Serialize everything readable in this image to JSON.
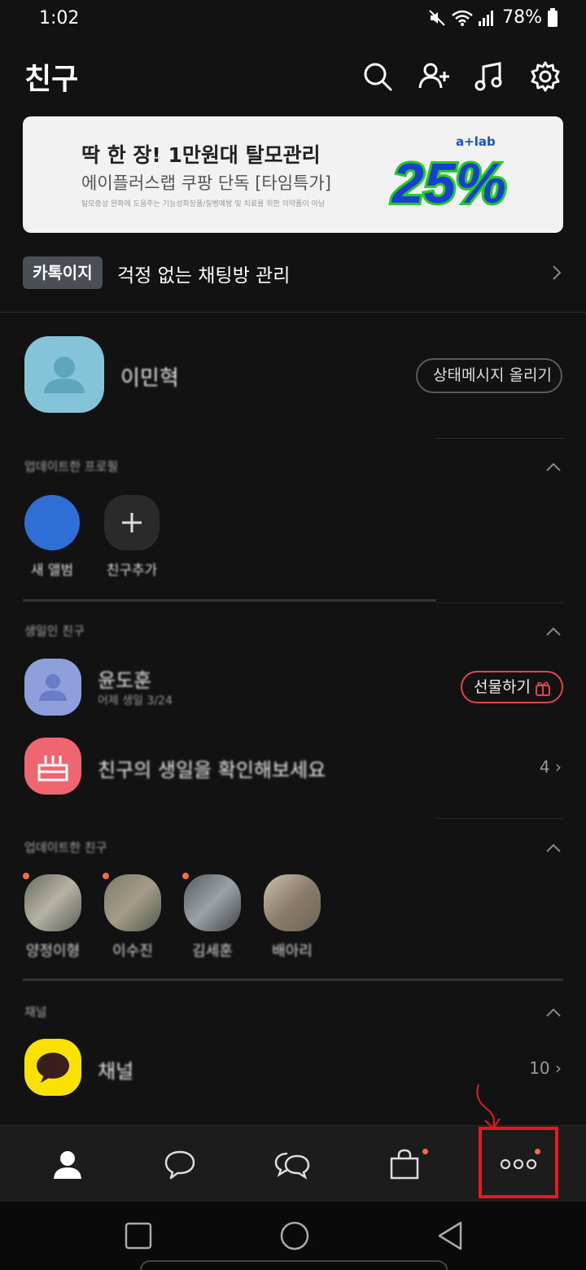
{
  "status_bar": {
    "time": "1:02",
    "battery": "78%"
  },
  "header": {
    "title": "친구",
    "icons": [
      "search-icon",
      "add-friend-icon",
      "music-icon",
      "settings-icon"
    ]
  },
  "ad": {
    "title": "딱 한 장! 1만원대 탈모관리",
    "subtitle": "에이플러스랩 쿠팡 단독 [타임특가]",
    "fine_print": "탈모증상 완화에 도움주는 기능성화장품/질병예방 및 치료를 위한 의약품이 아님",
    "brand": "a+lab",
    "badge": "25%"
  },
  "notice": {
    "tag": "카톡이지",
    "text": "걱정 없는 채팅방 관리"
  },
  "profile": {
    "name": "이민혁",
    "status_button": "상태메시지 올리기"
  },
  "sections": {
    "s1": {
      "title": "업데이트한 프로필",
      "tiles": [
        {
          "label": "새 앨범"
        },
        {
          "label": "친구추가"
        }
      ]
    },
    "s2": {
      "title": "생일인 친구",
      "rows": [
        {
          "name": "윤도훈",
          "sub": "어제 생일 3/24",
          "action": "선물하기"
        },
        {
          "name": "친구의 생일을 확인해보세요",
          "count": "4"
        }
      ]
    },
    "s3": {
      "title": "업데이트한 친구",
      "stories": [
        {
          "label": "양정이형"
        },
        {
          "label": "이수진"
        },
        {
          "label": "김세훈"
        },
        {
          "label": "배아리"
        }
      ]
    },
    "s4": {
      "title": "채널",
      "rows": [
        {
          "name": "채널",
          "count": "10"
        }
      ]
    }
  },
  "bottom_nav": {
    "items": [
      "friends-icon",
      "chat-icon",
      "openchat-icon",
      "shopping-icon",
      "more-icon"
    ]
  },
  "colors": {
    "background": "#121212",
    "accent_red": "#e0474a",
    "notification_dot": "#ff6a3d",
    "annotation": "#e6191e"
  }
}
